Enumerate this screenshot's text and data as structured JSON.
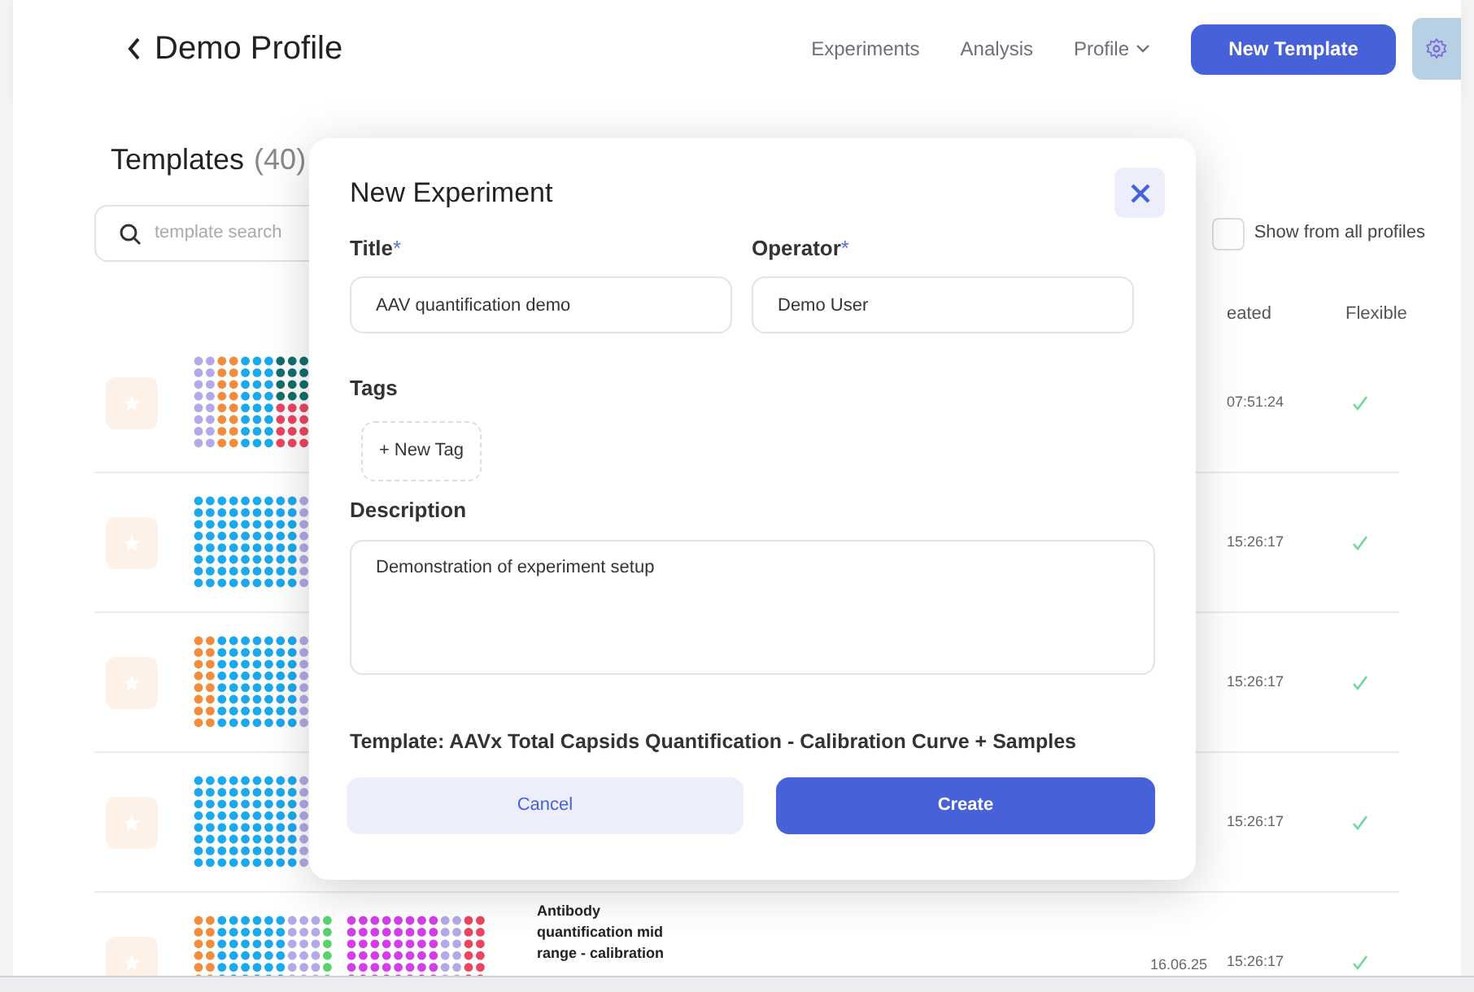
{
  "header": {
    "title": "Demo Profile",
    "nav": [
      {
        "label": "Experiments",
        "has_menu": false
      },
      {
        "label": "Analysis",
        "has_menu": false
      },
      {
        "label": "Profile",
        "has_menu": true
      }
    ],
    "primary_button": "New Template"
  },
  "templates": {
    "heading": "Templates",
    "count": "(40)",
    "search": {
      "placeholder": "template search"
    },
    "show_all": {
      "label": "Show from all profiles",
      "checked": false
    },
    "columns": [
      {
        "label": "eated"
      },
      {
        "label": "Flexible"
      }
    ],
    "rows": [
      {
        "time": "07:51:24",
        "flexible": true
      },
      {
        "time": "15:26:17",
        "flexible": true
      },
      {
        "time": "15:26:17",
        "flexible": true
      },
      {
        "time": "15:26:17",
        "flexible": true
      },
      {
        "name": "Antibody quantification mid range - calibration",
        "date": "16.06.25",
        "time": "15:26:17",
        "flexible": true
      }
    ]
  },
  "dialog": {
    "title": "New Experiment",
    "required_marker": "*",
    "fields": [
      {
        "label": "Title",
        "required": true,
        "value": "AAV quantification demo"
      },
      {
        "label": "Operator",
        "required": true,
        "value": "Demo User"
      }
    ],
    "tags_label": "Tags",
    "new_tag": "+ New Tag",
    "description_label": "Description",
    "description": "Demonstration of experiment setup",
    "template": "Template: AAVx Total Capsids Quantification - Calibration Curve + Samples",
    "cancel": "Cancel",
    "create": "Create"
  }
}
